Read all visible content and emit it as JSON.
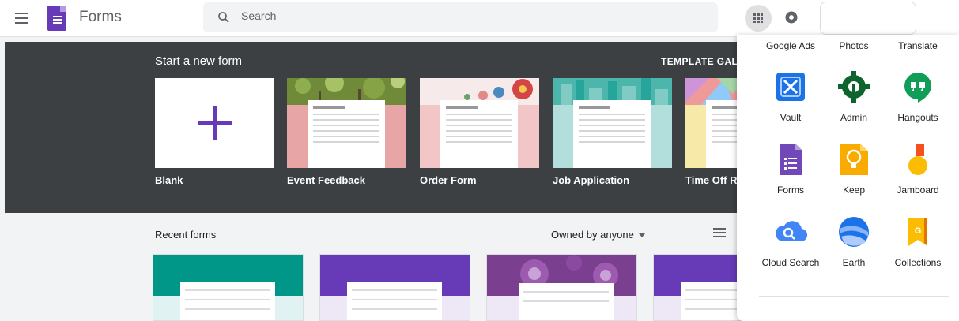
{
  "header": {
    "app_title": "Forms",
    "search_placeholder": "Search"
  },
  "hero": {
    "title": "Start a new form",
    "gallery_link": "TEMPLATE GALLE",
    "templates": [
      {
        "label": "Blank"
      },
      {
        "label": "Event Feedback"
      },
      {
        "label": "Order Form"
      },
      {
        "label": "Job Application"
      },
      {
        "label": "Time Off Re"
      }
    ]
  },
  "recent": {
    "title": "Recent forms",
    "owner_filter": "Owned by anyone"
  },
  "apps_panel": {
    "top_row": [
      "Google Ads",
      "Photos",
      "Translate"
    ],
    "apps": [
      {
        "label": "Vault",
        "icon": "vault-icon"
      },
      {
        "label": "Admin",
        "icon": "admin-icon"
      },
      {
        "label": "Hangouts",
        "icon": "hangouts-icon"
      },
      {
        "label": "Forms",
        "icon": "forms-icon"
      },
      {
        "label": "Keep",
        "icon": "keep-icon"
      },
      {
        "label": "Jamboard",
        "icon": "jamboard-icon"
      },
      {
        "label": "Cloud Search",
        "icon": "cloud-search-icon"
      },
      {
        "label": "Earth",
        "icon": "earth-icon"
      },
      {
        "label": "Collections",
        "icon": "collections-icon"
      }
    ]
  },
  "colors": {
    "forms_purple": "#673ab7",
    "hero_bg": "#3c4043",
    "teal": "#009688",
    "app_bg": "#f1f3f4"
  }
}
